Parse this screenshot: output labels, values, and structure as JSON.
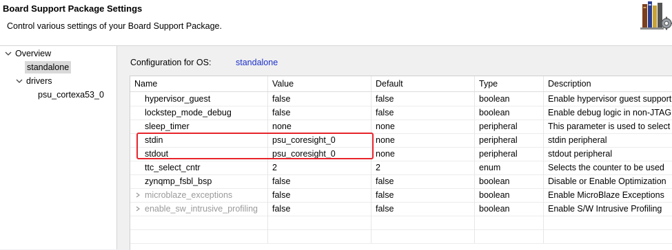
{
  "header": {
    "title": "Board Support Package Settings",
    "description": "Control various settings of your Board Support Package."
  },
  "tree": {
    "overview": "Overview",
    "standalone": "standalone",
    "drivers": "drivers",
    "driver_item": "psu_cortexa53_0"
  },
  "config": {
    "label": "Configuration for OS:",
    "value": "standalone"
  },
  "table": {
    "columns": [
      "Name",
      "Value",
      "Default",
      "Type",
      "Description"
    ],
    "rows": [
      {
        "name": "hypervisor_guest",
        "value": "false",
        "default": "false",
        "type": "boolean",
        "description": "Enable hypervisor guest support"
      },
      {
        "name": "lockstep_mode_debug",
        "value": "false",
        "default": "false",
        "type": "boolean",
        "description": "Enable debug logic in non-JTAG"
      },
      {
        "name": "sleep_timer",
        "value": "none",
        "default": "none",
        "type": "peripheral",
        "description": "This parameter is used to select"
      },
      {
        "name": "stdin",
        "value": "psu_coresight_0",
        "default": "none",
        "type": "peripheral",
        "description": "stdin peripheral"
      },
      {
        "name": "stdout",
        "value": "psu_coresight_0",
        "default": "none",
        "type": "peripheral",
        "description": "stdout peripheral"
      },
      {
        "name": "ttc_select_cntr",
        "value": "2",
        "default": "2",
        "type": "enum",
        "description": "Selects the counter to be used"
      },
      {
        "name": "zynqmp_fsbl_bsp",
        "value": "false",
        "default": "false",
        "type": "boolean",
        "description": "Disable or Enable Optimization"
      },
      {
        "name": "microblaze_exceptions",
        "value": "false",
        "default": "false",
        "type": "boolean",
        "description": "Enable MicroBlaze Exceptions"
      },
      {
        "name": "enable_sw_intrusive_profiling",
        "value": "false",
        "default": "false",
        "type": "boolean",
        "description": "Enable S/W Intrusive Profiling"
      }
    ]
  },
  "colors": {
    "highlight": "#e8232a",
    "link": "#1a2fc9"
  },
  "icons": {
    "banner": "books-gear-icon",
    "tree_expand": "chevron-down-icon",
    "row_expand": "chevron-right-icon"
  }
}
